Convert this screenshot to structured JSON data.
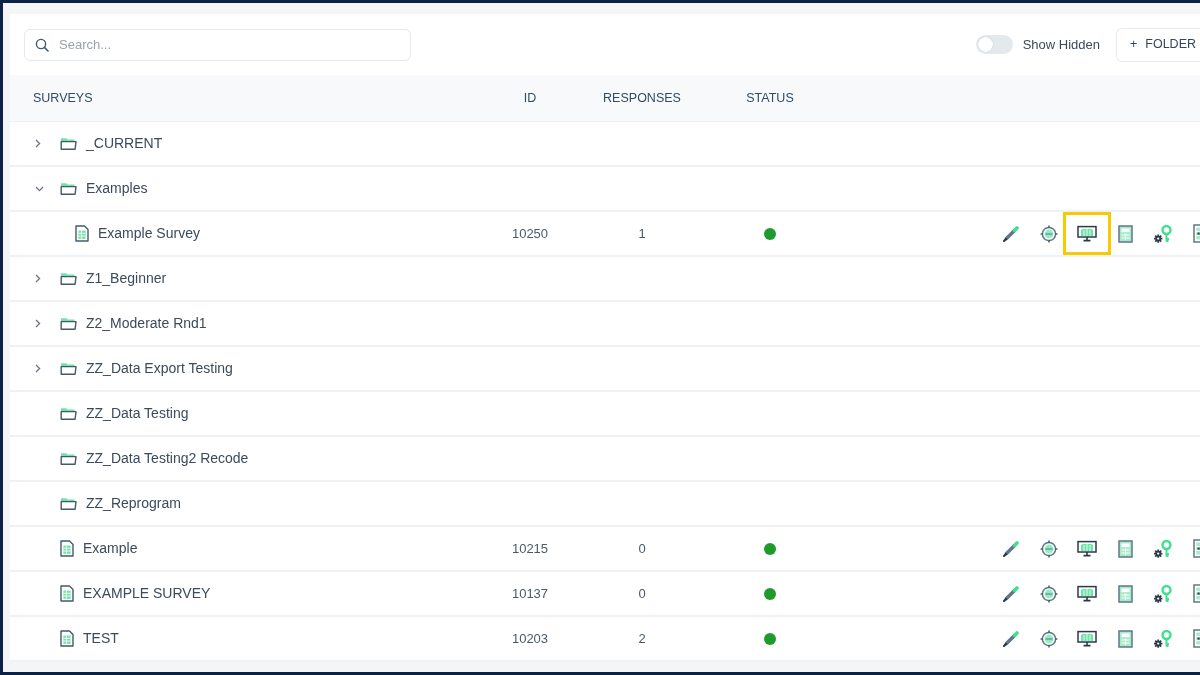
{
  "search": {
    "placeholder": "Search..."
  },
  "show_hidden": {
    "label": "Show Hidden",
    "on": false
  },
  "folder_button": {
    "symbol": "+",
    "label": "FOLDER"
  },
  "table": {
    "columns": [
      "SURVEYS",
      "ID",
      "RESPONSES",
      "STATUS"
    ],
    "rows": [
      {
        "kind": "folder",
        "name": "_CURRENT",
        "expanded": false
      },
      {
        "kind": "folder",
        "name": "Examples",
        "expanded": true,
        "children": [
          {
            "kind": "survey",
            "name": "Example Survey",
            "id": "10250",
            "responses": "1",
            "status": {
              "color": "#1f9a2c"
            },
            "actions": [
              {
                "kind": "pencil",
                "highlighted": false
              },
              {
                "kind": "crosshair",
                "highlighted": false
              },
              {
                "kind": "monitor",
                "highlighted": true
              },
              {
                "kind": "calculator",
                "highlighted": false
              },
              {
                "kind": "gear-key",
                "highlighted": false
              },
              {
                "kind": "sheet",
                "highlighted": false
              }
            ]
          }
        ]
      },
      {
        "kind": "folder",
        "name": "Z1_Beginner",
        "expanded": false
      },
      {
        "kind": "folder",
        "name": "Z2_Moderate Rnd1",
        "expanded": false
      },
      {
        "kind": "folder",
        "name": "ZZ_Data Export Testing",
        "expanded": false
      },
      {
        "kind": "folder",
        "name": "ZZ_Data Testing"
      },
      {
        "kind": "folder",
        "name": "ZZ_Data Testing2 Recode"
      },
      {
        "kind": "folder",
        "name": "ZZ_Reprogram"
      },
      {
        "kind": "survey",
        "name": "Example",
        "id": "10215",
        "responses": "0",
        "status": {
          "color": "#1f9a2c"
        },
        "actions": [
          {
            "kind": "pencil",
            "highlighted": false
          },
          {
            "kind": "crosshair",
            "highlighted": false
          },
          {
            "kind": "monitor",
            "highlighted": false
          },
          {
            "kind": "calculator",
            "highlighted": false
          },
          {
            "kind": "gear-key",
            "highlighted": false
          },
          {
            "kind": "sheet",
            "highlighted": false
          }
        ]
      },
      {
        "kind": "survey",
        "name": "EXAMPLE SURVEY",
        "id": "10137",
        "responses": "0",
        "status": {
          "color": "#1f9a2c"
        },
        "actions": [
          {
            "kind": "pencil",
            "highlighted": false
          },
          {
            "kind": "crosshair",
            "highlighted": false
          },
          {
            "kind": "monitor",
            "highlighted": false
          },
          {
            "kind": "calculator",
            "highlighted": false
          },
          {
            "kind": "gear-key",
            "highlighted": false
          },
          {
            "kind": "sheet",
            "highlighted": false
          }
        ]
      },
      {
        "kind": "survey",
        "name": "TEST",
        "id": "10203",
        "responses": "2",
        "status": {
          "color": "#1f9a2c"
        },
        "actions": [
          {
            "kind": "pencil",
            "highlighted": false
          },
          {
            "kind": "crosshair",
            "highlighted": false
          },
          {
            "kind": "monitor",
            "highlighted": false
          },
          {
            "kind": "calculator",
            "highlighted": false
          },
          {
            "kind": "gear-key",
            "highlighted": false
          },
          {
            "kind": "sheet",
            "highlighted": false
          }
        ]
      }
    ]
  }
}
